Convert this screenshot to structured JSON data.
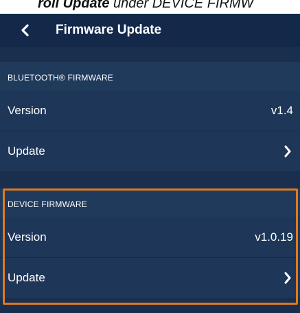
{
  "caption": {
    "bold_text": "roll Update",
    "rest_text": " under DEVICE FIRMW"
  },
  "header": {
    "back_icon": "chevron-left-icon",
    "title": "Firmware Update"
  },
  "bluetooth_section": {
    "header": "BLUETOOTH® FIRMWARE",
    "version_label": "Version",
    "version_value": "v1.4",
    "update_label": "Update",
    "update_icon": "chevron-right-icon"
  },
  "device_section": {
    "header": "DEVICE FIRMWARE",
    "version_label": "Version",
    "version_value": "v1.0.19",
    "update_label": "Update",
    "update_icon": "chevron-right-icon"
  },
  "colors": {
    "highlight": "#e07a1f",
    "background": "#1a2f4d",
    "row": "#1e3658"
  }
}
